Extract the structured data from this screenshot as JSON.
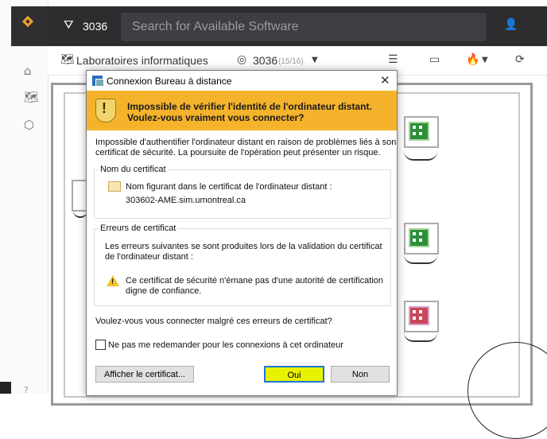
{
  "app": {
    "filter_count": "3036",
    "search_placeholder": "Search for Available Software"
  },
  "toolbar": {
    "location_label": "Laboratoires informatiques",
    "room_label": "3036",
    "room_count": "(15/16)"
  },
  "dialog": {
    "title": "Connexion Bureau à distance",
    "banner_line1": "Impossible de vérifier l'identité de l'ordinateur distant.",
    "banner_line2": "Voulez-vous vraiment vous connecter?",
    "intro_line1": "Impossible d'authentifier l'ordinateur distant en raison de problèmes liés à son",
    "intro_line2": "certificat de sécurité. La poursuite de l'opération peut présenter un risque.",
    "cert_group_label": "Nom du certificat",
    "cert_name_line1": "Nom figurant dans le certificat de l'ordinateur distant :",
    "cert_name_line2": "303602-AME.sim.umontreal.ca",
    "errors_group_label": "Erreurs de certificat",
    "errors_intro_line1": "Les erreurs suivantes se sont produites lors de la validation du certificat",
    "errors_intro_line2": "de l'ordinateur distant :",
    "error_line1": "Ce certificat de sécurité n'émane pas d'une autorité de certification",
    "error_line2": "digne de confiance.",
    "question": "Voulez-vous vous connecter malgré ces erreurs de certificat?",
    "checkbox_label": "Ne pas me redemander pour les connexions à cet ordinateur",
    "checkbox_checked": false,
    "btn_show_cert": "Afficher le certificat...",
    "btn_yes": "Oui",
    "btn_no": "Non"
  },
  "colors": {
    "banner": "#f4b32b",
    "topbar": "#2d2d30",
    "accent": "#f0a030",
    "station_ok": "#2d8f3a",
    "station_busy": "#c9475a"
  },
  "icons": {
    "filter": "filter-icon",
    "home": "home-icon",
    "map": "map-icon",
    "cube": "cube-icon",
    "user": "user-icon",
    "shield": "shield-warning-icon",
    "warning": "warning-icon",
    "refresh": "refresh-icon"
  }
}
